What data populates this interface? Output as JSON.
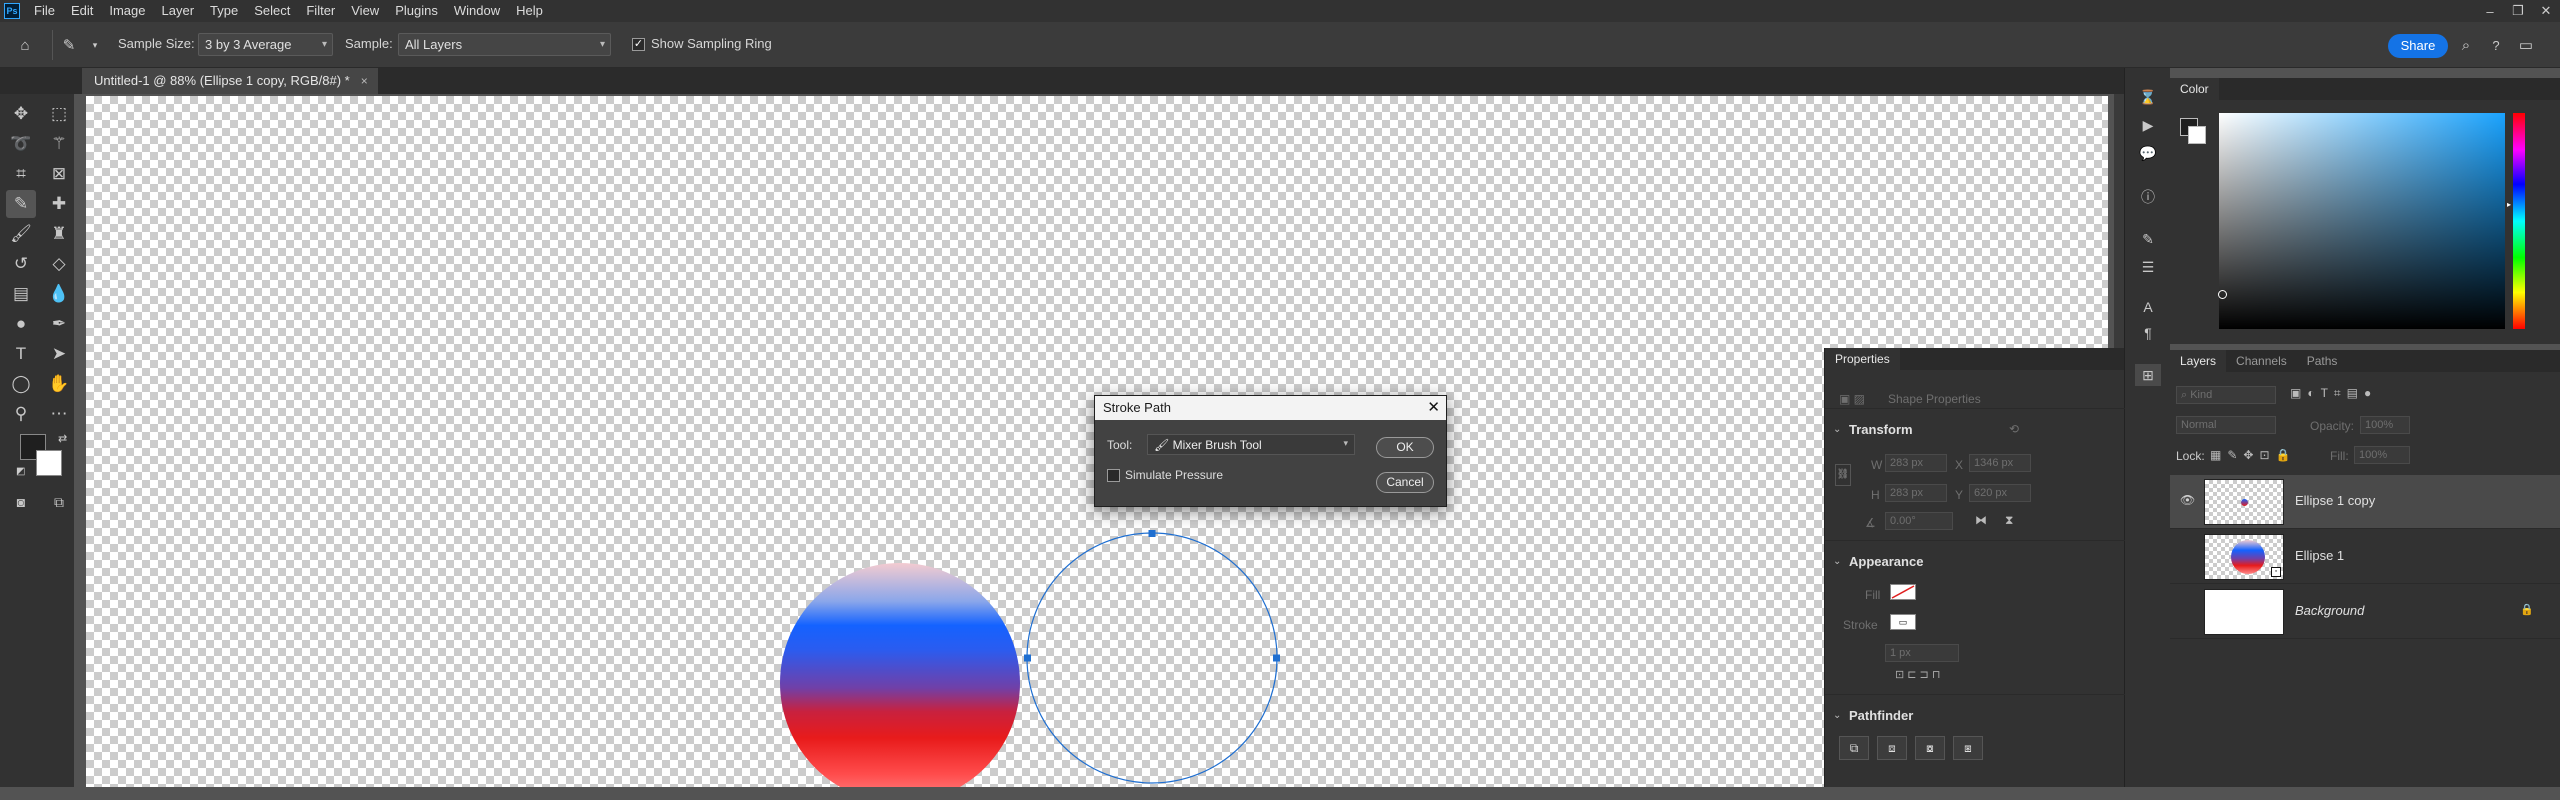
{
  "app": {
    "logo": "Ps"
  },
  "menubar": {
    "items": [
      "File",
      "Edit",
      "Image",
      "Layer",
      "Type",
      "Select",
      "Filter",
      "View",
      "Plugins",
      "Window",
      "Help"
    ]
  },
  "window_controls": {
    "minimize": "–",
    "restore": "❐",
    "close": "✕"
  },
  "options": {
    "sample_size_label": "Sample Size:",
    "sample_size_value": "3 by 3 Average",
    "sample_label": "Sample:",
    "sample_value": "All Layers",
    "show_sampling_ring_label": "Show Sampling Ring",
    "show_sampling_ring_checked": true,
    "share_label": "Share"
  },
  "document": {
    "tab_title": "Untitled-1 @ 88% (Ellipse 1 copy, RGB/8#) *",
    "tab_close": "×"
  },
  "stroke_dialog": {
    "title": "Stroke Path",
    "tool_label": "Tool:",
    "tool_value": "Mixer Brush Tool",
    "simulate_pressure_label": "Simulate Pressure",
    "ok_label": "OK",
    "cancel_label": "Cancel"
  },
  "properties": {
    "title": "Properties",
    "shape_properties_label": "Shape Properties",
    "transform_label": "Transform",
    "w_label": "W",
    "w_value": "283 px",
    "x_label": "X",
    "x_value": "1346 px",
    "h_label": "H",
    "h_value": "283 px",
    "y_label": "Y",
    "y_value": "620 px",
    "angle_value": "0.00°",
    "appearance_label": "Appearance",
    "fill_label": "Fill",
    "stroke_label": "Stroke",
    "stroke_width_value": "1 px",
    "pathfinder_label": "Pathfinder"
  },
  "color_panel": {
    "tab_label": "Color",
    "accent": "#1aa3ff"
  },
  "layers_panel": {
    "tabs": [
      "Layers",
      "Channels",
      "Paths"
    ],
    "kind_label": "Kind",
    "blend_mode": "Normal",
    "opacity_label": "Opacity:",
    "opacity_value": "100%",
    "lock_label": "Lock:",
    "fill_label": "Fill:",
    "fill_value": "100%",
    "layers": [
      {
        "name": "Ellipse 1 copy",
        "visible": true,
        "selected": true
      },
      {
        "name": "Ellipse 1",
        "visible": false,
        "selected": false
      },
      {
        "name": "Background",
        "visible": false,
        "selected": false,
        "locked": true
      }
    ]
  },
  "colors": {
    "share_blue": "#1473e6",
    "path_blue": "#1f6fd1"
  }
}
